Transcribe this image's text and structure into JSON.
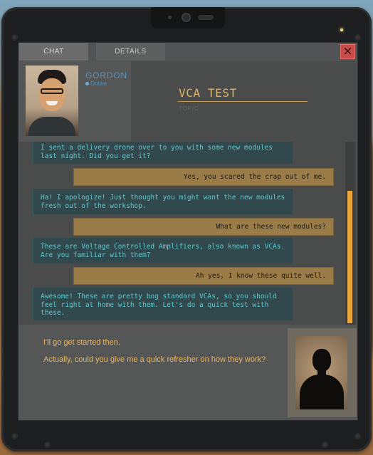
{
  "tabs": [
    {
      "label": "CHAT",
      "active": true
    },
    {
      "label": "DETAILS",
      "active": false
    }
  ],
  "close_icon": "×",
  "contact": {
    "name": "GORDON",
    "status": "Online",
    "status_color": "#6ab0da"
  },
  "conversation": {
    "title": "VCA TEST",
    "subtitle": "TOPIC"
  },
  "messages": [
    {
      "from": "them",
      "text": "I sent a delivery drone over to you with some new modules last night. Did you get it?"
    },
    {
      "from": "me",
      "text": "Yes, you scared the crap out of me."
    },
    {
      "from": "them",
      "text": "Ha! I apologize! Just thought you might want the new modules fresh out of the workshop."
    },
    {
      "from": "me",
      "text": "What are these new modules?"
    },
    {
      "from": "them",
      "text": "These are Voltage Controlled Amplifiers, also known as VCAs. Are you familiar with them?"
    },
    {
      "from": "me",
      "text": "Ah yes, I know these quite well."
    },
    {
      "from": "them",
      "text": "Awesome! These are pretty bog standard VCAs, so you should feel right at home with them. Let's do a quick test with these."
    }
  ],
  "reply_options": [
    "I'll go get started then.",
    "Actually, could you give me a quick refresher on how they work?"
  ],
  "colors": {
    "accent": "#e9a43a",
    "incoming_text": "#5fc9d1",
    "outgoing_bubble": "#9a7c48",
    "close_button": "#c84d4a"
  }
}
